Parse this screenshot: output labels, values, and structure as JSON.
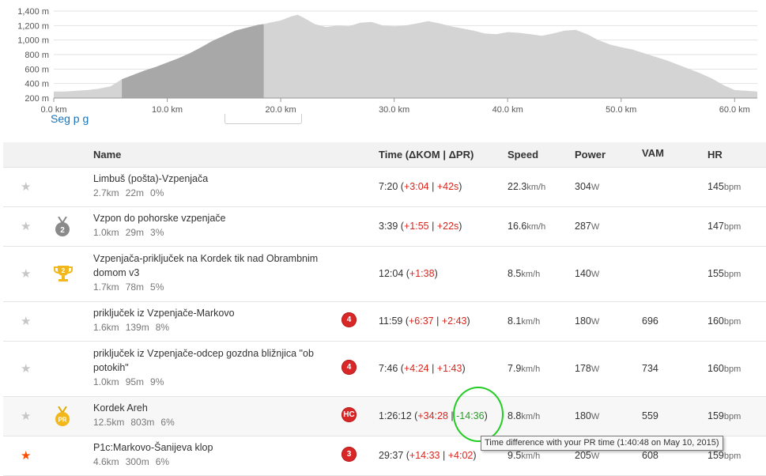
{
  "chart_data": {
    "type": "area",
    "y_ticks": [
      "1,400 m",
      "1,200 m",
      "1,000 m",
      "800 m",
      "600 m",
      "400 m",
      "200 m"
    ],
    "x_ticks": [
      "0.0 km",
      "10.0 km",
      "20.0 km",
      "30.0 km",
      "40.0 km",
      "50.0 km",
      "60.0 km"
    ],
    "xlim": [
      0,
      62
    ],
    "ylim": [
      200,
      1400
    ],
    "highlight_range_km": [
      6.0,
      18.5
    ],
    "x": [
      0,
      1,
      2,
      3,
      4,
      5,
      6,
      7,
      8,
      9,
      10,
      11,
      12,
      13,
      14,
      15,
      16,
      17,
      18,
      18.5,
      19,
      20,
      21,
      21.5,
      22,
      23,
      24,
      25,
      26,
      27,
      28,
      29,
      30,
      31,
      32,
      33,
      34,
      35,
      36,
      37,
      38,
      39,
      40,
      41,
      42,
      43,
      44,
      45,
      46,
      47,
      48,
      49,
      50,
      51,
      52,
      53,
      54,
      55,
      56,
      57,
      58,
      59,
      60,
      61,
      62
    ],
    "y": [
      290,
      290,
      300,
      310,
      330,
      360,
      460,
      520,
      580,
      630,
      690,
      750,
      820,
      900,
      990,
      1060,
      1130,
      1170,
      1210,
      1220,
      1240,
      1270,
      1330,
      1350,
      1310,
      1220,
      1180,
      1200,
      1190,
      1240,
      1250,
      1200,
      1190,
      1200,
      1230,
      1260,
      1230,
      1190,
      1160,
      1130,
      1090,
      1080,
      1110,
      1100,
      1080,
      1060,
      1090,
      1130,
      1140,
      1080,
      1000,
      940,
      900,
      870,
      820,
      770,
      720,
      660,
      600,
      540,
      470,
      380,
      310,
      300,
      290
    ],
    "colors": {
      "area": "#d4d4d4",
      "highlight": "#a8a8a8",
      "grid": "#e2e2e2",
      "axis": "#999999"
    }
  },
  "header_ghost": {
    "text": "Seg p  g"
  },
  "table": {
    "headers": {
      "name": "Name",
      "time": "Time (ΔKOM | ΔPR)",
      "speed": "Speed",
      "power": "Power",
      "vam": "VAM",
      "hr": "HR"
    },
    "rows": [
      {
        "starred": false,
        "medal": "",
        "name": "Limbuš (pošta)-Vzpenjača",
        "dist": "2.7km",
        "elev": "22m",
        "grade": "0%",
        "cat": "",
        "time": "7:20",
        "kom": "+3:04",
        "pr": "+42s",
        "pr_positive": false,
        "speed": "22.3",
        "power": "304",
        "vam": "",
        "hr": "145"
      },
      {
        "starred": false,
        "medal": "2",
        "name": "Vzpon do pohorske vzpenjače",
        "dist": "1.0km",
        "elev": "29m",
        "grade": "3%",
        "cat": "",
        "time": "3:39",
        "kom": "+1:55",
        "pr": "+22s",
        "pr_positive": false,
        "speed": "16.6",
        "power": "287",
        "vam": "",
        "hr": "147"
      },
      {
        "starred": false,
        "medal": "cup",
        "name": "Vzpenjača-priključek na Kordek tik nad Obrambnim domom v3",
        "dist": "1.7km",
        "elev": "78m",
        "grade": "5%",
        "cat": "",
        "time": "12:04",
        "kom": "+1:38",
        "pr": "",
        "pr_positive": false,
        "speed": "8.5",
        "power": "140",
        "vam": "",
        "hr": "155"
      },
      {
        "starred": false,
        "medal": "",
        "name": "priključek iz Vzpenjače-Markovo",
        "dist": "1.6km",
        "elev": "139m",
        "grade": "8%",
        "cat": "4",
        "time": "11:59",
        "kom": "+6:37",
        "pr": "+2:43",
        "pr_positive": false,
        "speed": "8.1",
        "power": "180",
        "vam": "696",
        "hr": "160"
      },
      {
        "starred": false,
        "medal": "",
        "name": "priključek iz Vzpenjače-odcep gozdna bližnjica \"ob potokih\"",
        "dist": "1.0km",
        "elev": "95m",
        "grade": "9%",
        "cat": "4",
        "time": "7:46",
        "kom": "+4:24",
        "pr": "+1:43",
        "pr_positive": false,
        "speed": "7.9",
        "power": "178",
        "vam": "734",
        "hr": "160"
      },
      {
        "starred": false,
        "medal": "PR",
        "name": "Kordek Areh",
        "dist": "12.5km",
        "elev": "803m",
        "grade": "6%",
        "cat": "HC",
        "time": "1:26:12",
        "kom": "+34:28",
        "pr": "-14:36",
        "pr_positive": true,
        "speed": "8.8",
        "power": "180",
        "vam": "559",
        "hr": "159"
      },
      {
        "starred": true,
        "medal": "",
        "name": "P1c:Markovo-Šanijeva klop",
        "dist": "4.6km",
        "elev": "300m",
        "grade": "6%",
        "cat": "3",
        "time": "29:37",
        "kom": "+14:33",
        "pr": "+4:02",
        "pr_positive": false,
        "speed": "9.5",
        "power": "205",
        "vam": "608",
        "hr": "159"
      }
    ],
    "units": {
      "speed": "km/h",
      "power": "W",
      "hr": "bpm"
    }
  },
  "tooltip": {
    "text": "Time difference with your PR time (1:40:48 on May 10, 2015)"
  },
  "icons": {
    "star": "star-icon",
    "medal2": "silver-medal-icon",
    "cup": "gold-trophy-icon",
    "pr": "pr-medal-icon"
  }
}
